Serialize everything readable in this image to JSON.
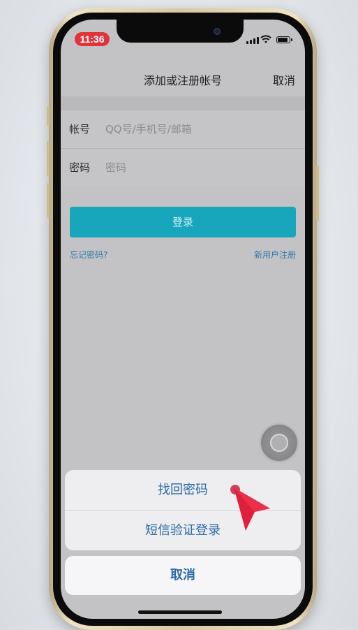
{
  "status_bar": {
    "time": "11:36"
  },
  "nav": {
    "title": "添加或注册帐号",
    "cancel": "取消"
  },
  "form": {
    "account": {
      "label": "帐号",
      "placeholder": "QQ号/手机号/邮箱"
    },
    "password": {
      "label": "密码",
      "placeholder": "密码"
    }
  },
  "login_button": "登录",
  "links": {
    "forgot": "忘记密码?",
    "register": "新用户注册"
  },
  "action_sheet": {
    "items": [
      "找回密码",
      "短信验证登录"
    ],
    "cancel": "取消"
  },
  "colors": {
    "primary": "#17a6bc",
    "sheet_text": "#2b6aa8",
    "time_pill": "#e0343d",
    "pointer": "#e01f3d"
  }
}
